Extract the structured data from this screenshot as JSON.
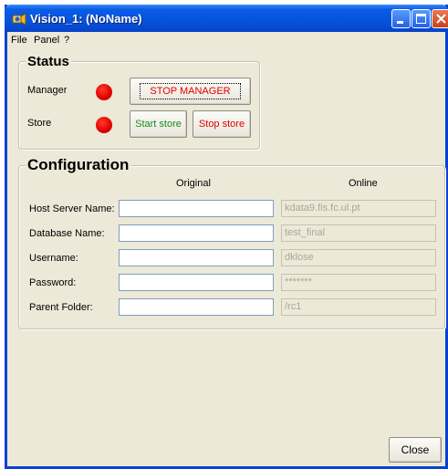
{
  "window": {
    "title": "Vision_1: (NoName)"
  },
  "menu": [
    "File",
    "Panel",
    "?"
  ],
  "status": {
    "title": "Status",
    "manager_label": "Manager",
    "store_label": "Store",
    "led_color": "#e00000",
    "stop_manager_label": "STOP MANAGER",
    "start_store_label": "Start store",
    "stop_store_label": "Stop store"
  },
  "configuration": {
    "title": "Configuration",
    "col_original": "Original",
    "col_online": "Online",
    "fields": [
      {
        "label": "Host Server Name:",
        "original": "",
        "online": "kdata9.fis.fc.ul.pt"
      },
      {
        "label": "Database Name:",
        "original": "",
        "online": "test_final"
      },
      {
        "label": "Username:",
        "original": "",
        "online": "dklose"
      },
      {
        "label": "Password:",
        "original": "",
        "online": "*******"
      },
      {
        "label": "Parent Folder:",
        "original": "",
        "online": "/rc1"
      }
    ]
  },
  "footer": {
    "close_label": "Close"
  },
  "colors": {
    "title_bar": "#0653de",
    "window_bg": "#ece9d8",
    "stop_red": "#e00000",
    "start_green": "#1a8a1a"
  }
}
